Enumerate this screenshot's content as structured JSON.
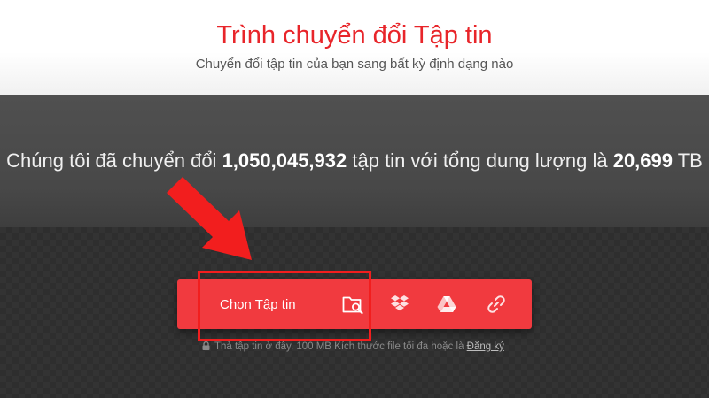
{
  "header": {
    "title": "Trình chuyển đổi Tập tin",
    "subtitle": "Chuyển đổi tập tin của bạn sang bất kỳ định dạng nào"
  },
  "stats": {
    "prefix": "Chúng tôi đã chuyển đổi ",
    "files_count": "1,050,045,932",
    "middle": " tập tin với tổng dung lượng là ",
    "total_size": "20,699",
    "unit": " TB"
  },
  "upload": {
    "choose_label": "Chọn Tập tin",
    "icons": [
      "folder-search-icon",
      "dropbox-icon",
      "google-drive-icon",
      "link-icon"
    ],
    "hint_text": "Thả tập tin ở đây. 100 MB Kích thước file tối đa hoặc là ",
    "signup_label": "Đăng ký"
  },
  "colors": {
    "brand_red": "#e8252a",
    "button_red": "#f13a3f",
    "annotation_red": "#f21e1e"
  }
}
